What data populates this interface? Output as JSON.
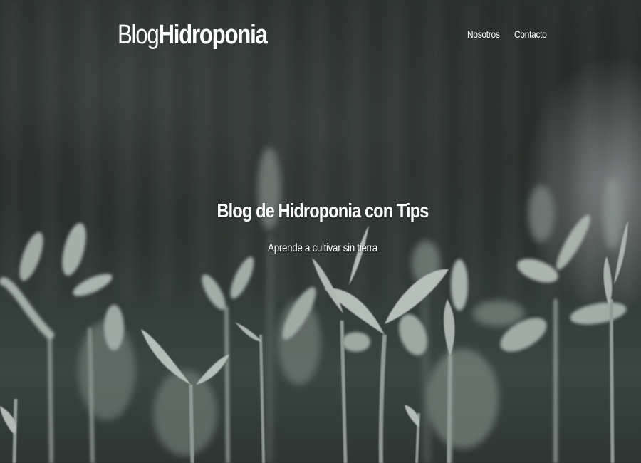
{
  "header": {
    "brand_light": "Blog",
    "brand_bold": "Hidroponia",
    "nav": [
      {
        "label": "Nosotros"
      },
      {
        "label": "Contacto"
      }
    ]
  },
  "hero": {
    "title": "Blog de Hidroponia con Tips",
    "subtitle": "Aprende a cultivar sin tierra",
    "background": "seedlings-photo"
  },
  "colors": {
    "text": "#ffffff",
    "overlay": "#2a302d",
    "leaf": "#9aa79e"
  }
}
